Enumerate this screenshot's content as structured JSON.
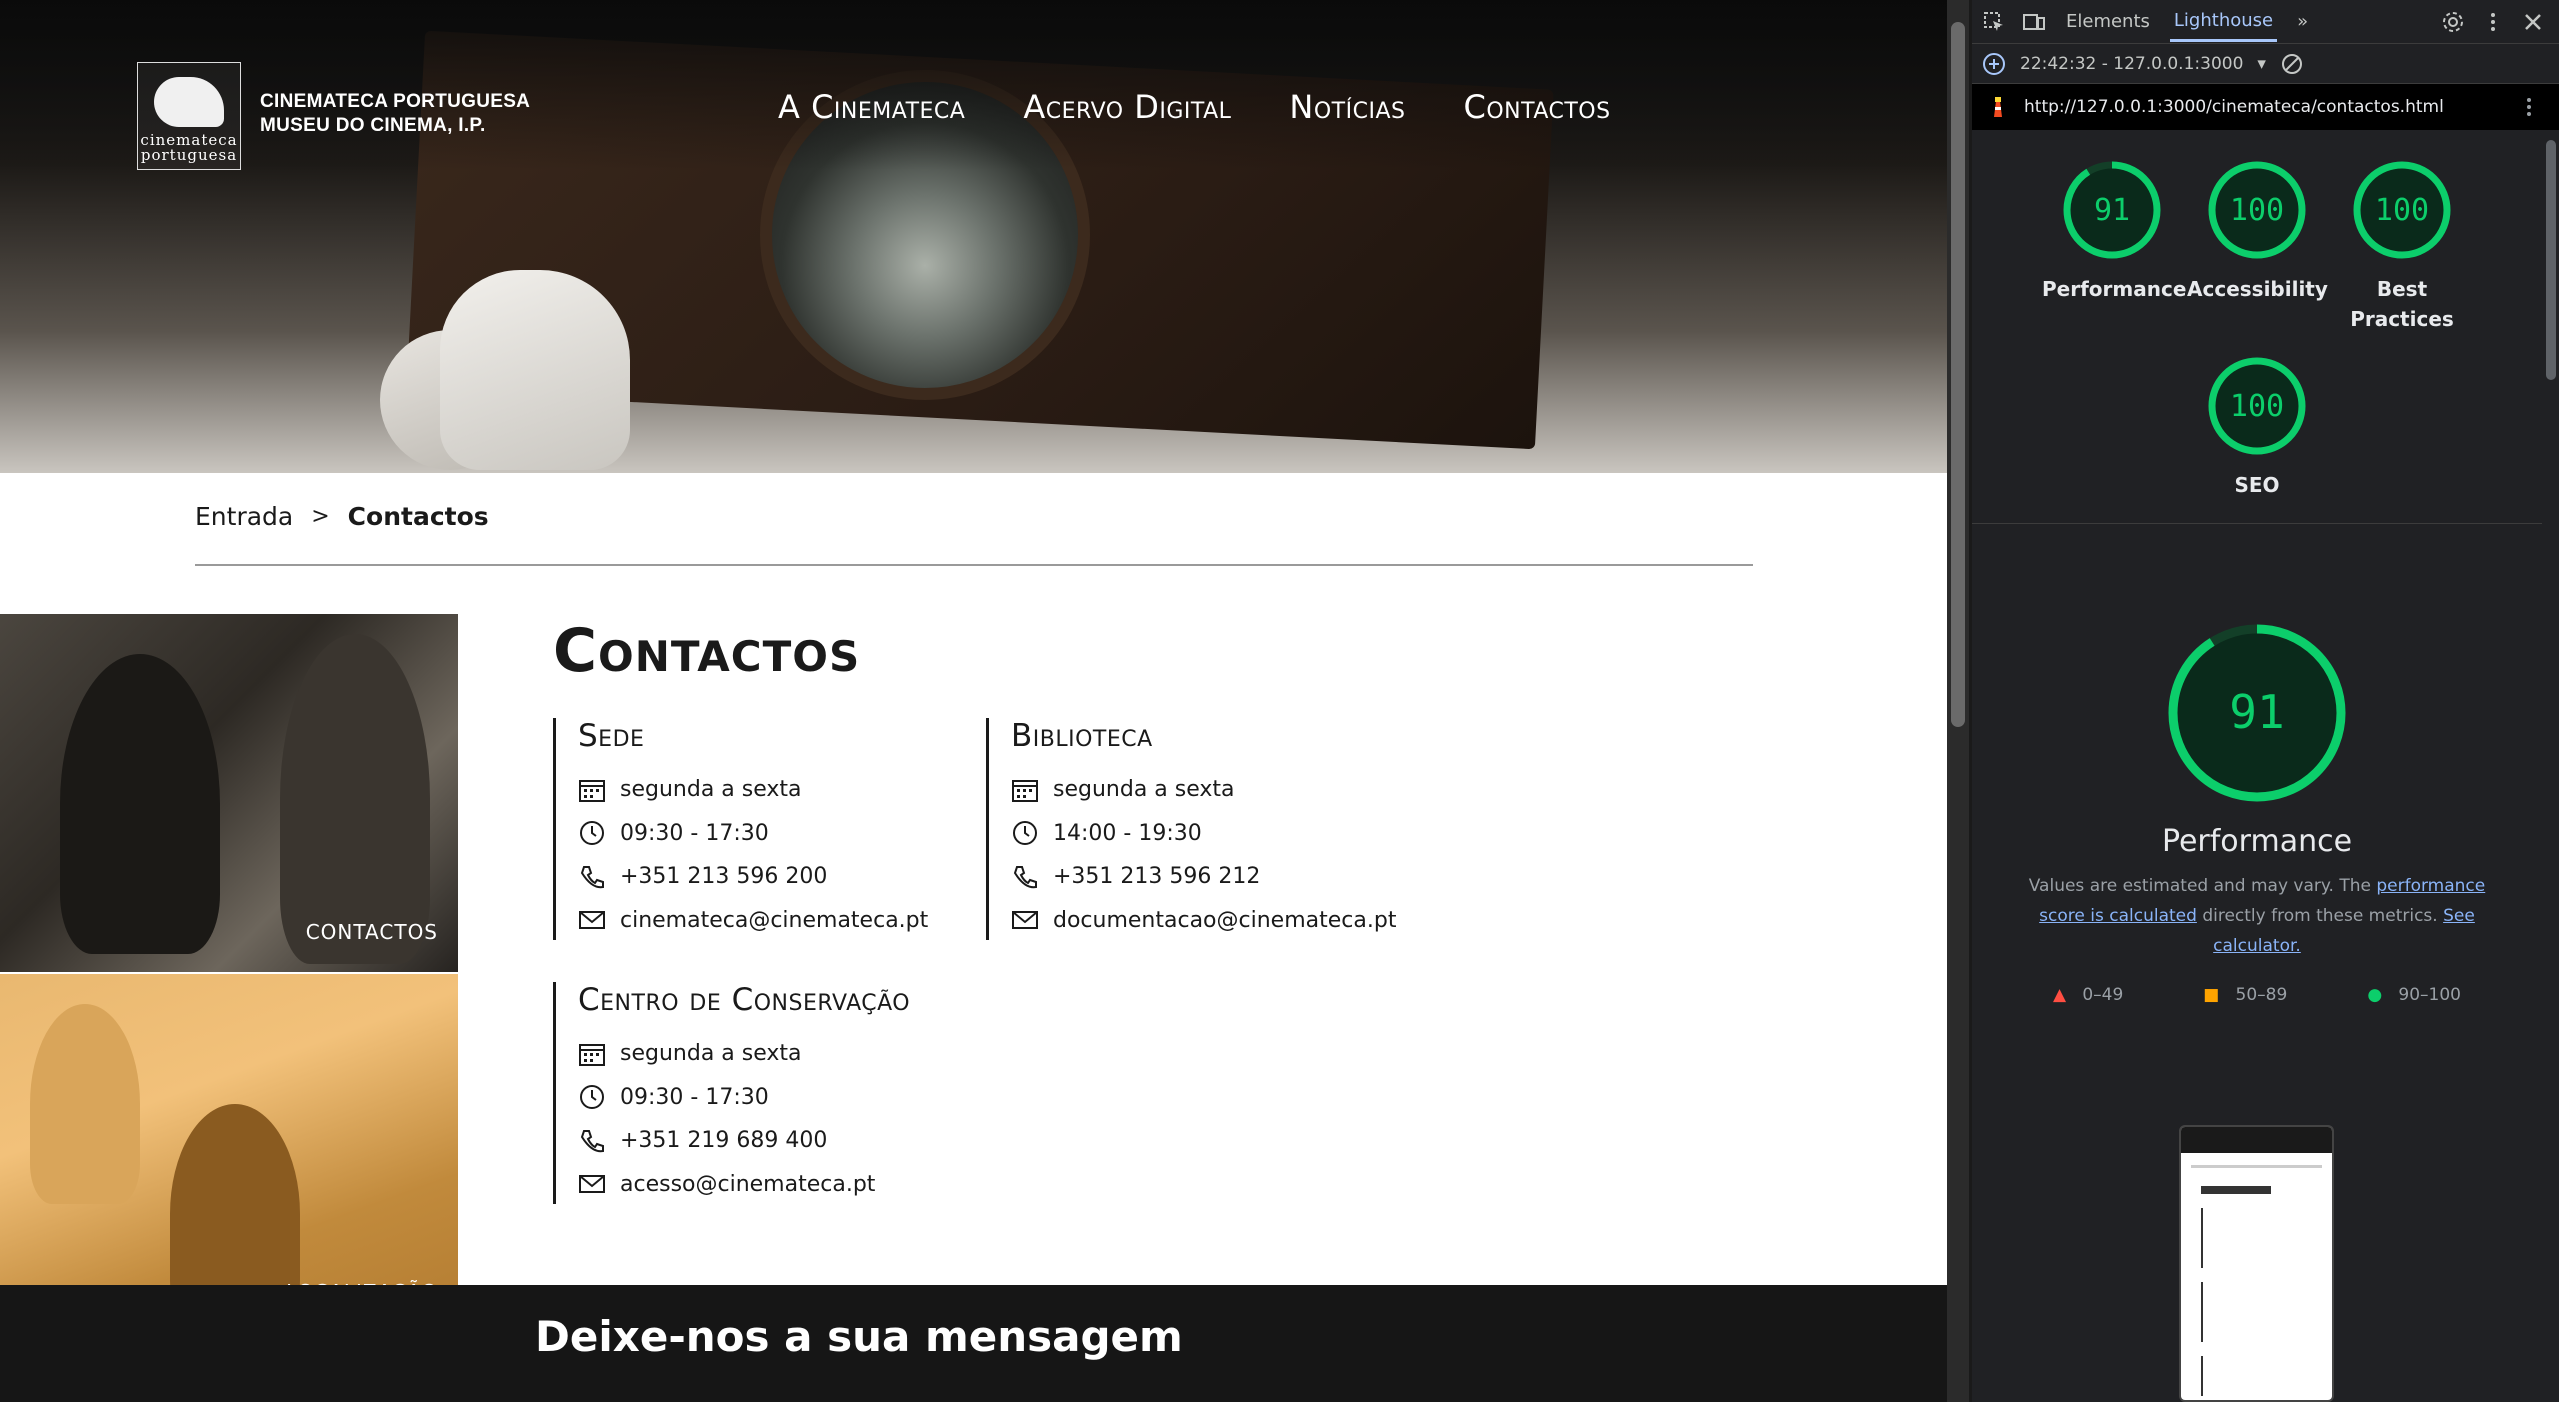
{
  "header": {
    "logo_text": "cinemateca portuguesa",
    "brand_line1": "CINEMATECA PORTUGUESA",
    "brand_line2": "MUSEU DO CINEMA, I.P.",
    "nav": [
      "A Cinemateca",
      "Acervo Digital",
      "Notícias",
      "Contactos"
    ]
  },
  "breadcrumb": {
    "home": "Entrada",
    "separator": ">",
    "current": "Contactos"
  },
  "tiles": [
    {
      "label": "CONTACTOS"
    },
    {
      "label": "LOCALIZAÇÃO"
    }
  ],
  "page_title": "Contactos",
  "blocks": {
    "sede": {
      "title": "Sede",
      "days": "segunda a sexta",
      "hours": "09:30 - 17:30",
      "phone": "+351 213 596 200",
      "email": "cinemateca@cinemateca.pt"
    },
    "biblioteca": {
      "title": "Biblioteca",
      "days": "segunda a sexta",
      "hours": "14:00 - 19:30",
      "phone": "+351 213 596 212",
      "email": "documentacao@cinemateca.pt"
    },
    "conservacao": {
      "title": "Centro de Conservação",
      "days": "segunda a sexta",
      "hours": "09:30 - 17:30",
      "phone": "+351 219 689 400",
      "email": "acesso@cinemateca.pt"
    }
  },
  "footer": {
    "title": "Deixe-nos a sua mensagem"
  },
  "devtools": {
    "tabs": [
      "Elements",
      "Lighthouse"
    ],
    "active_tab": "Lighthouse",
    "more": "»",
    "report_selector": "22:42:32 - 127.0.0.1:3000",
    "url": "http://127.0.0.1:3000/cinemateca/contactos.html",
    "scores": [
      {
        "label": "Performance",
        "value": 91
      },
      {
        "label": "Accessibility",
        "value": 100
      },
      {
        "label": "Best Practices",
        "value": 100
      },
      {
        "label": "SEO",
        "value": 100
      }
    ],
    "main_score": {
      "value": 91,
      "label": "Performance"
    },
    "note_prefix": "Values are estimated and may vary. The",
    "note_link1": "performance score is calculated",
    "note_mid": "directly from these metrics.",
    "note_link2": "See calculator.",
    "legend": [
      "0–49",
      "50–89",
      "90–100"
    ],
    "colors": {
      "pass": "#0cce6b",
      "average": "#ffa400",
      "fail": "#ff4e42"
    }
  }
}
